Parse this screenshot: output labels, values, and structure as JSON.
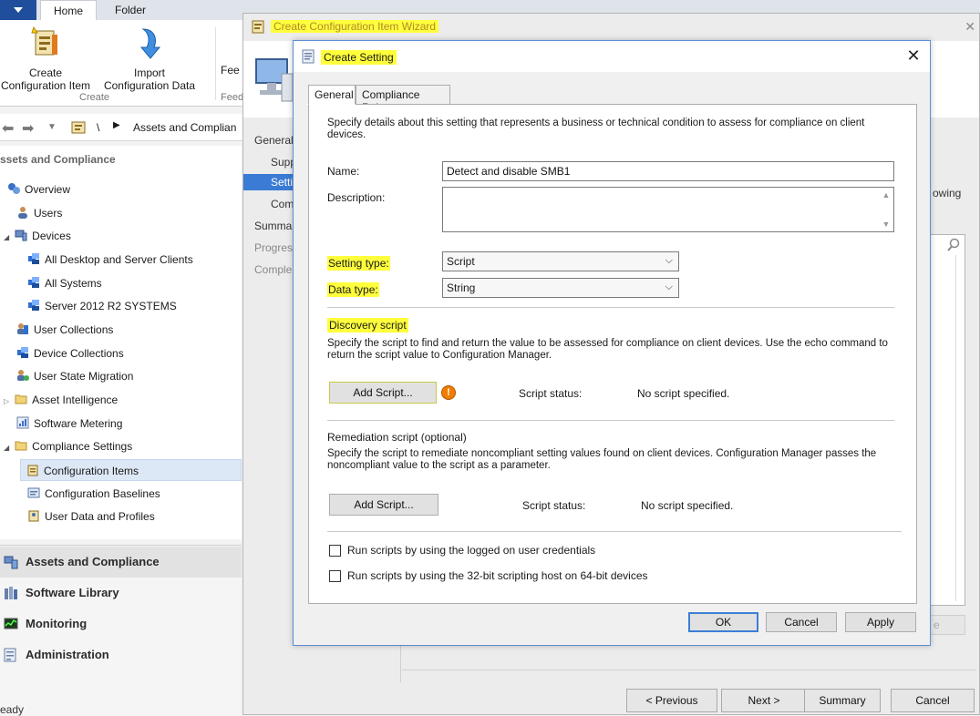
{
  "ribbon": {
    "tabs": [
      "Home",
      "Folder"
    ],
    "buttons": [
      {
        "line1": "Create",
        "line2": "Configuration Item"
      },
      {
        "line1": "Import",
        "line2": "Configuration Data"
      }
    ],
    "partial_button": "Fee",
    "partial_group": "Feed",
    "group_create": "Create"
  },
  "navbar": {
    "separator": "\\",
    "path": "Assets and Complian"
  },
  "tree": {
    "header": "ssets and Compliance",
    "items": [
      {
        "label": "Overview"
      },
      {
        "label": "Users"
      },
      {
        "label": "Devices"
      },
      {
        "label": "All Desktop and Server Clients"
      },
      {
        "label": "All Systems"
      },
      {
        "label": "Server 2012  R2 SYSTEMS"
      },
      {
        "label": "User Collections"
      },
      {
        "label": "Device Collections"
      },
      {
        "label": "User State Migration"
      },
      {
        "label": "Asset Intelligence"
      },
      {
        "label": "Software Metering"
      },
      {
        "label": "Compliance Settings"
      },
      {
        "label": "Configuration Items"
      },
      {
        "label": "Configuration Baselines"
      },
      {
        "label": "User Data and Profiles"
      }
    ]
  },
  "workspaces": [
    {
      "label": "Assets and Compliance"
    },
    {
      "label": "Software Library"
    },
    {
      "label": "Monitoring"
    },
    {
      "label": "Administration"
    }
  ],
  "status_bar": "eady",
  "wizard": {
    "title": "Create Configuration Item Wizard",
    "steps": [
      "General",
      "Supp",
      "Setti",
      "Com",
      "Summa",
      "Progres",
      "Comple"
    ],
    "side_text": "owing",
    "buttons": {
      "previous": "< Previous",
      "next": "Next >",
      "summary": "Summary",
      "cancel": "Cancel"
    },
    "partial_button": "e"
  },
  "dialog": {
    "title": "Create Setting",
    "close": "✕",
    "tabs": [
      "General",
      "Compliance Rules"
    ],
    "intro": "Specify details about this setting that represents a business or technical condition to assess for compliance on client devices.",
    "name_label": "Name:",
    "name_value": "Detect and disable SMB1",
    "description_label": "Description:",
    "setting_type_label": "Setting type:",
    "setting_type_value": "Script",
    "data_type_label": "Data type:",
    "data_type_value": "String",
    "discovery": {
      "heading": "Discovery script",
      "description": "Specify the script to find and return the value to be assessed for compliance on client devices. Use the echo command to return the script value to Configuration Manager.",
      "button": "Add Script...",
      "status_label": "Script status:",
      "status_value": "No script specified."
    },
    "remediation": {
      "heading": "Remediation script (optional)",
      "description": "Specify the script to remediate noncompliant setting values found on client devices. Configuration Manager passes the noncompliant value to the script as a parameter.",
      "button": "Add Script...",
      "status_label": "Script status:",
      "status_value": "No script specified."
    },
    "checkbox_logged_on": "Run scripts by using the logged on user credentials",
    "checkbox_32bit": "Run scripts by using the 32-bit scripting host on 64-bit devices",
    "buttons": {
      "ok": "OK",
      "cancel": "Cancel",
      "apply": "Apply"
    }
  },
  "colors": {
    "highlight": "#ffff3c",
    "accent": "#3a7bd5",
    "warning": "#f07d00"
  }
}
